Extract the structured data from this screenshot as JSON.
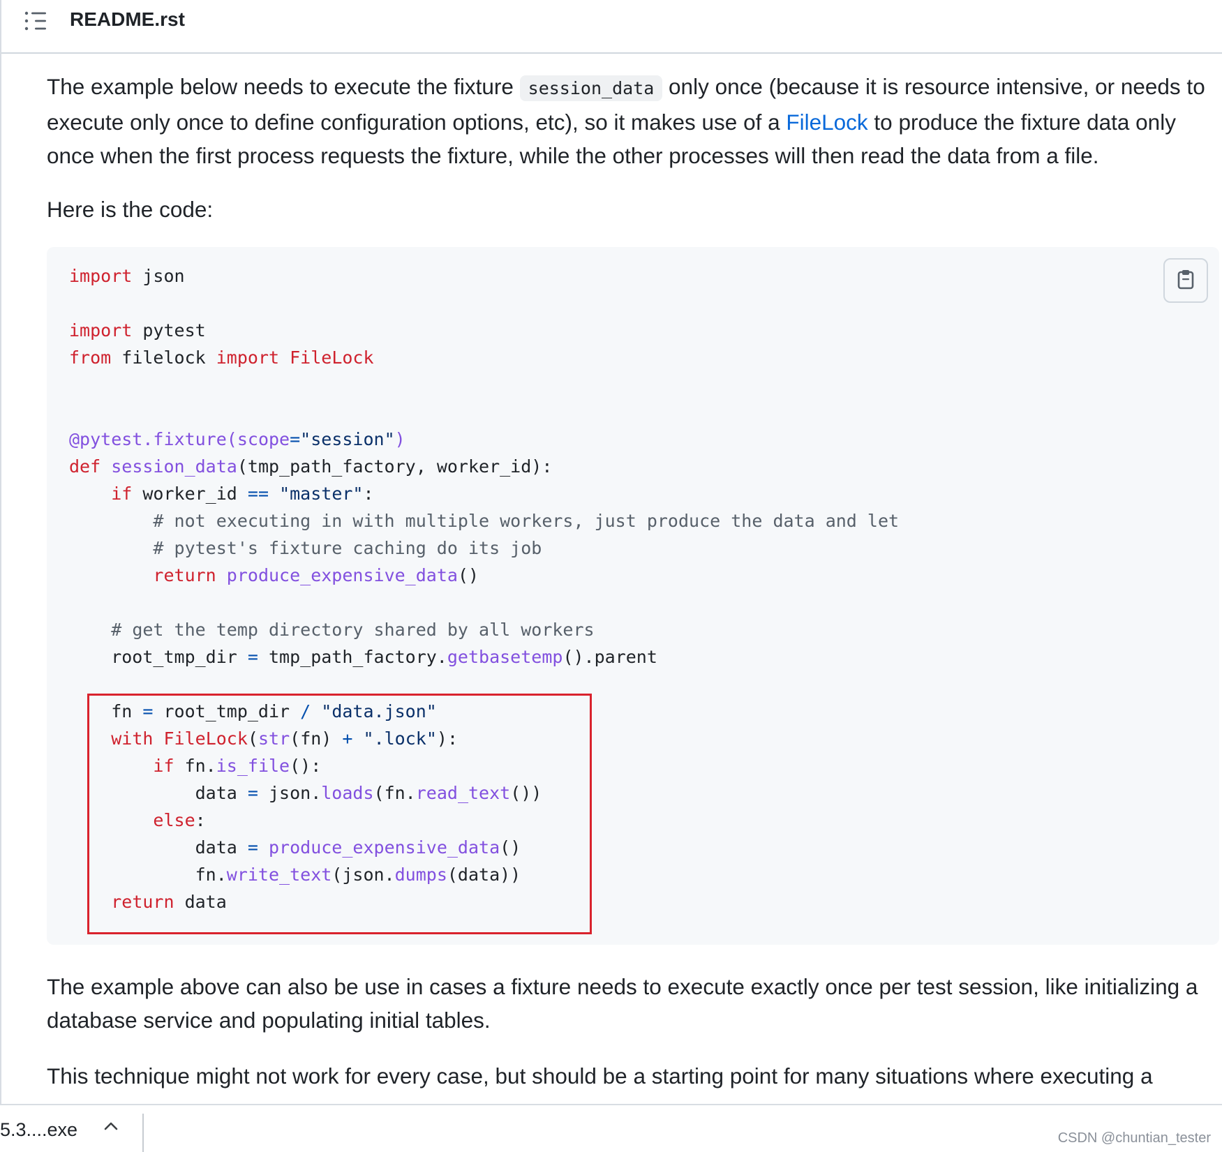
{
  "header": {
    "title": "README.rst",
    "toc_icon": "list-icon"
  },
  "content": {
    "para1": {
      "before_code": "The example below needs to execute the fixture ",
      "inline_code": "session_data",
      "after_code": " only once (because it is resource intensive, or needs to execute only once to define configuration options, etc), so it makes use of a ",
      "link": "FileLock",
      "after_link": " to produce the fixture data only once when the first process requests the fixture, while the other processes will then read the data from a file."
    },
    "para2": "Here is the code:",
    "para3": "The example above can also be use in cases a fixture needs to execute exactly once per test session, like initializing a database service and populating initial tables.",
    "para4": "This technique might not work for every case, but should be a starting point for many situations where executing a"
  },
  "code_block": {
    "copy_icon": "clipboard-icon",
    "highlight_color": "#d9232d",
    "lines": [
      "import json",
      "",
      "import pytest",
      "from filelock import FileLock",
      "",
      "",
      "@pytest.fixture(scope=\"session\")",
      "def session_data(tmp_path_factory, worker_id):",
      "    if worker_id == \"master\":",
      "        # not executing in with multiple workers, just produce the data and let",
      "        # pytest's fixture caching do its job",
      "        return produce_expensive_data()",
      "",
      "    # get the temp directory shared by all workers",
      "    root_tmp_dir = tmp_path_factory.getbasetemp().parent",
      "",
      "    fn = root_tmp_dir / \"data.json\"",
      "    with FileLock(str(fn) + \".lock\"):",
      "        if fn.is_file():",
      "            data = json.loads(fn.read_text())",
      "        else:",
      "            data = produce_expensive_data()",
      "            fn.write_text(json.dumps(data))",
      "    return data"
    ]
  },
  "download_bar": {
    "file_name": "5.3....exe",
    "chevron_icon": "chevron-up-icon"
  },
  "watermark": "CSDN @chuntian_tester",
  "colors": {
    "link": "#0969da",
    "keyword": "#cf222e",
    "function": "#8250df",
    "string": "#0a3069",
    "comment": "#57606a"
  }
}
